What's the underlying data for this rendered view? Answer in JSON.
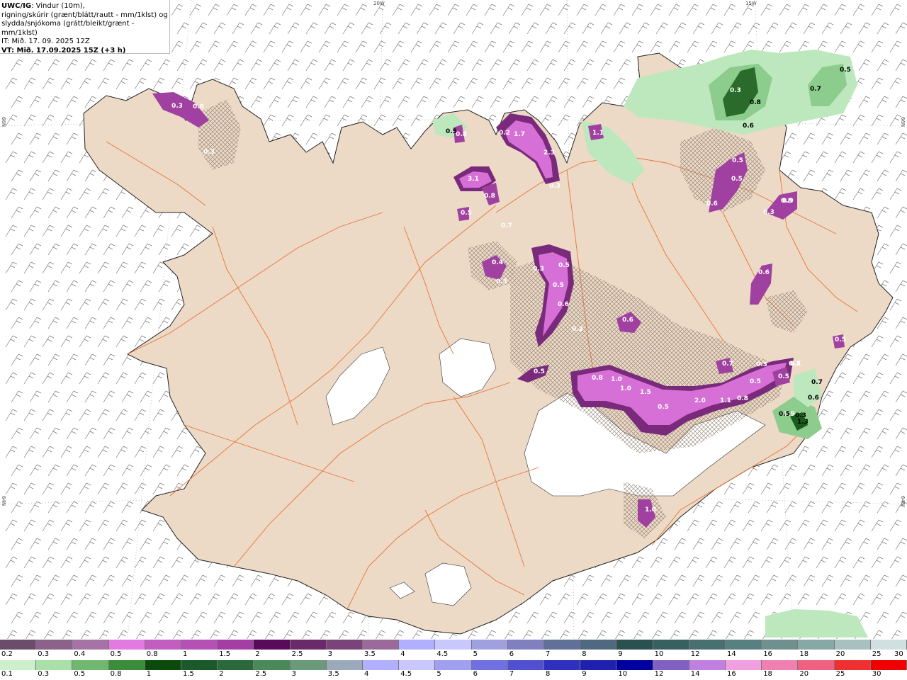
{
  "header": {
    "model": "UWC/IG",
    "field_line1": ": Vindur (10m),",
    "field_line2": "rigning/skúrir (grænt/blátt/rautt - mm/1klst) og",
    "field_line3": "slydda/snjókoma (grátt/bleikt/grænt - mm/1klst)",
    "it_line": "IT: Mið. 17. 09. 2025 12Z",
    "vt_line": "VT: Mið. 17.09.2025 15Z (+3 h)"
  },
  "grid_labels": {
    "lon_20w": "20W",
    "lon_15w": "15W",
    "lat_66n_left": "66N",
    "lat_66n_right": "66N",
    "lat_64n_left": "64N",
    "lat_64n_right": "64N"
  },
  "colorbar_snow": {
    "labels": [
      "0.2",
      "0.3",
      "0.4",
      "0.5",
      "0.8",
      "1",
      "1.5",
      "2",
      "2.5",
      "3",
      "3.5",
      "4",
      "4.5",
      "5",
      "6",
      "7",
      "8",
      "9",
      "10",
      "12",
      "14",
      "16",
      "18",
      "20",
      "25",
      "30"
    ],
    "colors": [
      "#6b4d6b",
      "#8a628a",
      "#a673a6",
      "#e27ae2",
      "#c25ec2",
      "#b550b5",
      "#a43ea4",
      "#5a0a5a",
      "#6a2a6a",
      "#7a447a",
      "#9a6a9a",
      "#b0b0ff",
      "#c8c8ff",
      "#a0a0e0",
      "#8080c0",
      "#607098",
      "#506880",
      "#2a5050",
      "#386060",
      "#487070",
      "#588080",
      "#709090",
      "#88a8a8",
      "#a8c0c0",
      "#d0e0e0"
    ]
  },
  "colorbar_rain": {
    "labels": [
      "0.1",
      "0.3",
      "0.5",
      "0.8",
      "1",
      "1.5",
      "2",
      "2.5",
      "3",
      "3.5",
      "4",
      "4.5",
      "5",
      "6",
      "7",
      "8",
      "9",
      "10",
      "12",
      "14",
      "16",
      "18",
      "20",
      "25",
      "30"
    ],
    "colors": [
      "#ccf0cc",
      "#a8e0a8",
      "#70b870",
      "#3c8c3c",
      "#0a4a0a",
      "#1a5a2a",
      "#2a6a3a",
      "#4a8a5a",
      "#6a9a7a",
      "#9aaaba",
      "#b0b0ff",
      "#c8c8ff",
      "#a0a0f0",
      "#7070e0",
      "#5050d0",
      "#3030c0",
      "#2020b0",
      "#0000a0",
      "#8060c0",
      "#c080e0",
      "#f0a0e0",
      "#f080b0",
      "#f06080",
      "#f03030",
      "#f00000"
    ]
  },
  "precip_labels": [
    {
      "text": "0.3",
      "color": "#ffffff"
    },
    {
      "text": "0.6",
      "color": "#ffffff"
    },
    {
      "text": "0.3",
      "color": "#ffffff"
    },
    {
      "text": "0.5",
      "color": "#000000"
    },
    {
      "text": "0.8",
      "color": "#ffffff"
    },
    {
      "text": "0.2",
      "color": "#ffffff"
    },
    {
      "text": "1.7",
      "color": "#ffffff"
    },
    {
      "text": "2.3",
      "color": "#ffffff"
    },
    {
      "text": "0.3",
      "color": "#ffffff"
    },
    {
      "text": "3.1",
      "color": "#ffffff"
    },
    {
      "text": "0.8",
      "color": "#ffffff"
    },
    {
      "text": "0.5",
      "color": "#ffffff"
    },
    {
      "text": "0.7",
      "color": "#ffffff"
    },
    {
      "text": "0.4",
      "color": "#ffffff"
    },
    {
      "text": "0.3",
      "color": "#ffffff"
    },
    {
      "text": "0.3",
      "color": "#ffffff"
    },
    {
      "text": "0.5",
      "color": "#ffffff"
    },
    {
      "text": "0.5",
      "color": "#ffffff"
    },
    {
      "text": "0.6",
      "color": "#ffffff"
    },
    {
      "text": "0.2",
      "color": "#ffffff"
    },
    {
      "text": "0.6",
      "color": "#ffffff"
    },
    {
      "text": "0.5",
      "color": "#ffffff"
    },
    {
      "text": "0.8",
      "color": "#ffffff"
    },
    {
      "text": "1.0",
      "color": "#ffffff"
    },
    {
      "text": "1.0",
      "color": "#ffffff"
    },
    {
      "text": "1.5",
      "color": "#ffffff"
    },
    {
      "text": "0.5",
      "color": "#ffffff"
    },
    {
      "text": "2.0",
      "color": "#ffffff"
    },
    {
      "text": "1.1",
      "color": "#ffffff"
    },
    {
      "text": "0.8",
      "color": "#ffffff"
    },
    {
      "text": "0.5",
      "color": "#ffffff"
    },
    {
      "text": "0.7",
      "color": "#ffffff"
    },
    {
      "text": "0.1",
      "color": "#ffffff"
    },
    {
      "text": "0.5",
      "color": "#ffffff"
    },
    {
      "text": "0.3",
      "color": "#ffffff"
    },
    {
      "text": "1.9",
      "color": "#ffffff"
    },
    {
      "text": "0.5",
      "color": "#ffffff"
    },
    {
      "text": "0.5",
      "color": "#ffffff"
    },
    {
      "text": "0.6",
      "color": "#ffffff"
    },
    {
      "text": "0.8",
      "color": "#ffffff"
    },
    {
      "text": "0.3",
      "color": "#ffffff"
    },
    {
      "text": "0.9",
      "color": "#ffffff"
    },
    {
      "text": "0.6",
      "color": "#ffffff"
    },
    {
      "text": "0.5",
      "color": "#ffffff"
    },
    {
      "text": "0.1",
      "color": "#ffffff"
    },
    {
      "text": "1.1",
      "color": "#ffffff"
    },
    {
      "text": "0.8",
      "color": "#000000"
    },
    {
      "text": "0.3",
      "color": "#ffffff"
    },
    {
      "text": "0.6",
      "color": "#000000"
    },
    {
      "text": "0.7",
      "color": "#000000"
    },
    {
      "text": "0.5",
      "color": "#000000"
    },
    {
      "text": "0.7",
      "color": "#000000"
    },
    {
      "text": "0.6",
      "color": "#000000"
    },
    {
      "text": "0.5",
      "color": "#000000"
    },
    {
      "text": "0.3",
      "color": "#000000"
    },
    {
      "text": "1.3",
      "color": "#000000"
    },
    {
      "text": "1.0",
      "color": "#ffffff"
    }
  ],
  "colors": {
    "land": "#ecd9c6",
    "glacier": "#ffffff",
    "roads": "#e8753a",
    "snow_light": "#c880c8",
    "snow_mid": "#b040b0",
    "snow_dark": "#7a2a7a",
    "rain_light": "#bde8bd",
    "rain_mid": "#6ab06a",
    "rain_dark": "#1a5a1a"
  }
}
